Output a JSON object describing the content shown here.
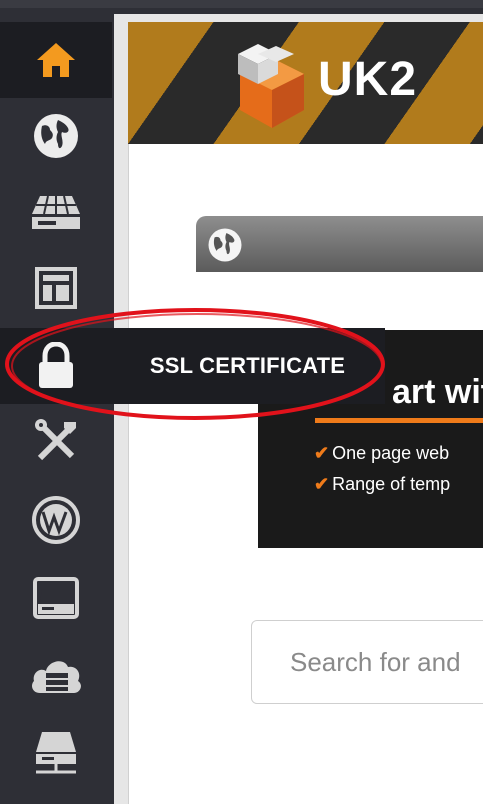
{
  "brand": {
    "logo_text": "UK2",
    "brand_color": "#b17b1c"
  },
  "sidebar": {
    "items": [
      {
        "name": "home",
        "icon": "home-icon",
        "active": true
      },
      {
        "name": "domains",
        "icon": "globe-icon"
      },
      {
        "name": "hosting",
        "icon": "server-rack-icon"
      },
      {
        "name": "website-builder",
        "icon": "layout-icon"
      },
      {
        "name": "ssl",
        "icon": "lock-icon",
        "tooltip": "SSL CERTIFICATE"
      },
      {
        "name": "tools",
        "icon": "tools-icon"
      },
      {
        "name": "wordpress",
        "icon": "wordpress-icon"
      },
      {
        "name": "storage",
        "icon": "drive-icon"
      },
      {
        "name": "cloud",
        "icon": "cloud-server-icon"
      },
      {
        "name": "network",
        "icon": "network-drive-icon"
      }
    ]
  },
  "tooltip": {
    "label": "SSL CERTIFICATE"
  },
  "promo": {
    "title": "art wit",
    "bullets": [
      "One page web",
      "Range of temp"
    ],
    "accent": "#ef7b1a"
  },
  "search": {
    "placeholder": "Search for and"
  },
  "annotation": {
    "shape": "ellipse",
    "color": "#e1121b",
    "target": "ssl-sidebar-item"
  }
}
